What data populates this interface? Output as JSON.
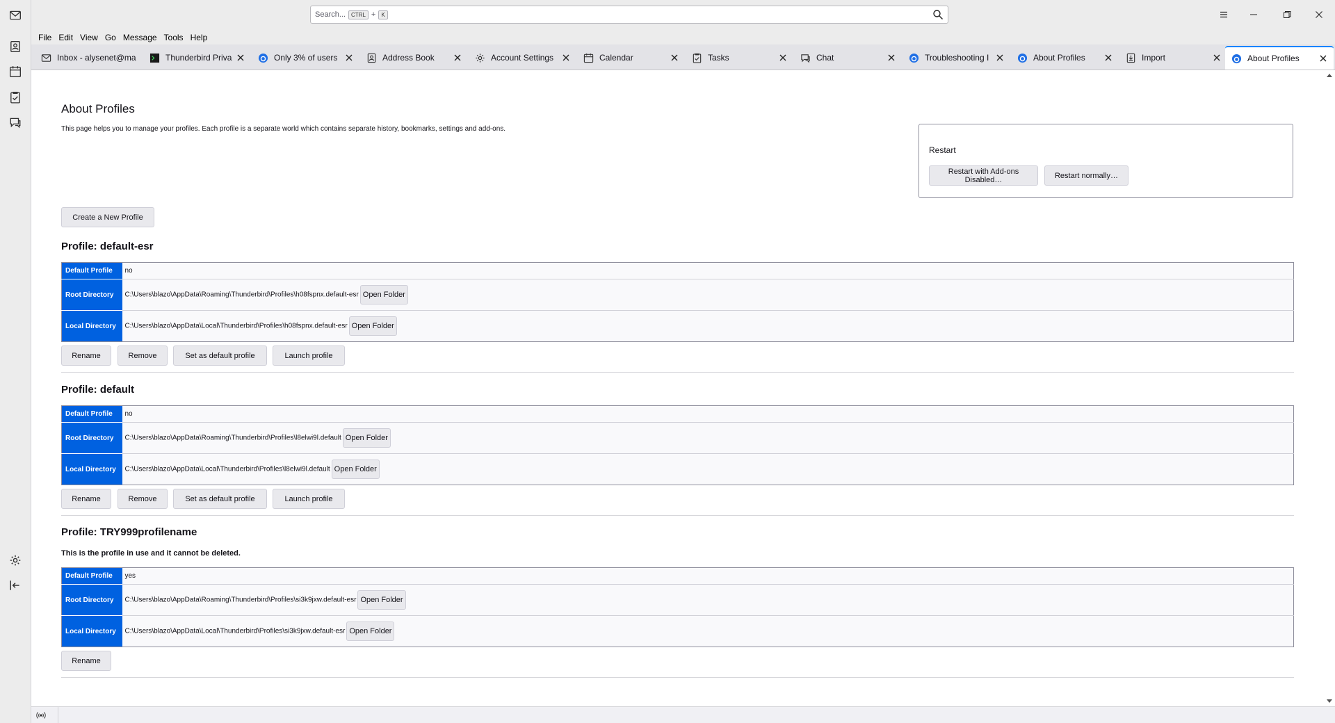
{
  "spaces": {
    "items": [
      "mail",
      "address-book",
      "calendar",
      "tasks",
      "chat"
    ],
    "settings": "settings",
    "collapse": "collapse"
  },
  "search": {
    "placeholder": "Search...",
    "shortcut_ctrl": "CTRL",
    "shortcut_plus": "+",
    "shortcut_key": "K"
  },
  "menubar": {
    "file": "File",
    "edit": "Edit",
    "view": "View",
    "go": "Go",
    "message": "Message",
    "tools": "Tools",
    "help": "Help"
  },
  "tabs": [
    {
      "label": "Inbox - alysenet@ma",
      "icon": "mail-icon"
    },
    {
      "label": "Thunderbird Priva",
      "icon": "terminal-icon"
    },
    {
      "label": "Only 3% of users",
      "icon": "thunderbird-icon"
    },
    {
      "label": "Address Book",
      "icon": "address-book-icon"
    },
    {
      "label": "Account Settings",
      "icon": "gear-icon"
    },
    {
      "label": "Calendar",
      "icon": "calendar-icon"
    },
    {
      "label": "Tasks",
      "icon": "tasks-icon"
    },
    {
      "label": "Chat",
      "icon": "chat-icon"
    },
    {
      "label": "Troubleshooting I",
      "icon": "thunderbird-icon"
    },
    {
      "label": "About Profiles",
      "icon": "thunderbird-icon"
    },
    {
      "label": "Import",
      "icon": "import-icon"
    },
    {
      "label": "About Profiles",
      "icon": "thunderbird-icon",
      "active": true
    }
  ],
  "page": {
    "title": "About Profiles",
    "description": "This page helps you to manage your profiles. Each profile is a separate world which contains separate history, bookmarks, settings and add-ons.",
    "restart": {
      "title": "Restart",
      "addons_disabled_btn": "Restart with Add-ons Disabled…",
      "normally_btn": "Restart normally…"
    },
    "create_btn": "Create a New Profile",
    "labels": {
      "default_profile": "Default Profile",
      "root_dir": "Root Directory",
      "local_dir": "Local Directory",
      "open_folder": "Open Folder",
      "rename": "Rename",
      "remove": "Remove",
      "set_default": "Set as default profile",
      "launch": "Launch profile"
    },
    "profiles": [
      {
        "heading": "Profile: default-esr",
        "default": "no",
        "root": "C:\\Users\\blazo\\AppData\\Roaming\\Thunderbird\\Profiles\\h08fspnx.default-esr",
        "local": "C:\\Users\\blazo\\AppData\\Local\\Thunderbird\\Profiles\\h08fspnx.default-esr"
      },
      {
        "heading": "Profile: default",
        "default": "no",
        "root": "C:\\Users\\blazo\\AppData\\Roaming\\Thunderbird\\Profiles\\l8elwi9l.default",
        "local": "C:\\Users\\blazo\\AppData\\Local\\Thunderbird\\Profiles\\l8elwi9l.default"
      },
      {
        "heading": "Profile: TRY999profilename",
        "note": "This is the profile in use and it cannot be deleted.",
        "default": "yes",
        "root": "C:\\Users\\blazo\\AppData\\Roaming\\Thunderbird\\Profiles\\si3k9jxw.default-esr",
        "local": "C:\\Users\\blazo\\AppData\\Local\\Thunderbird\\Profiles\\si3k9jxw.default-esr"
      }
    ]
  },
  "colors": {
    "accent": "#0061e0",
    "tab_accent": "#0a84ff"
  }
}
